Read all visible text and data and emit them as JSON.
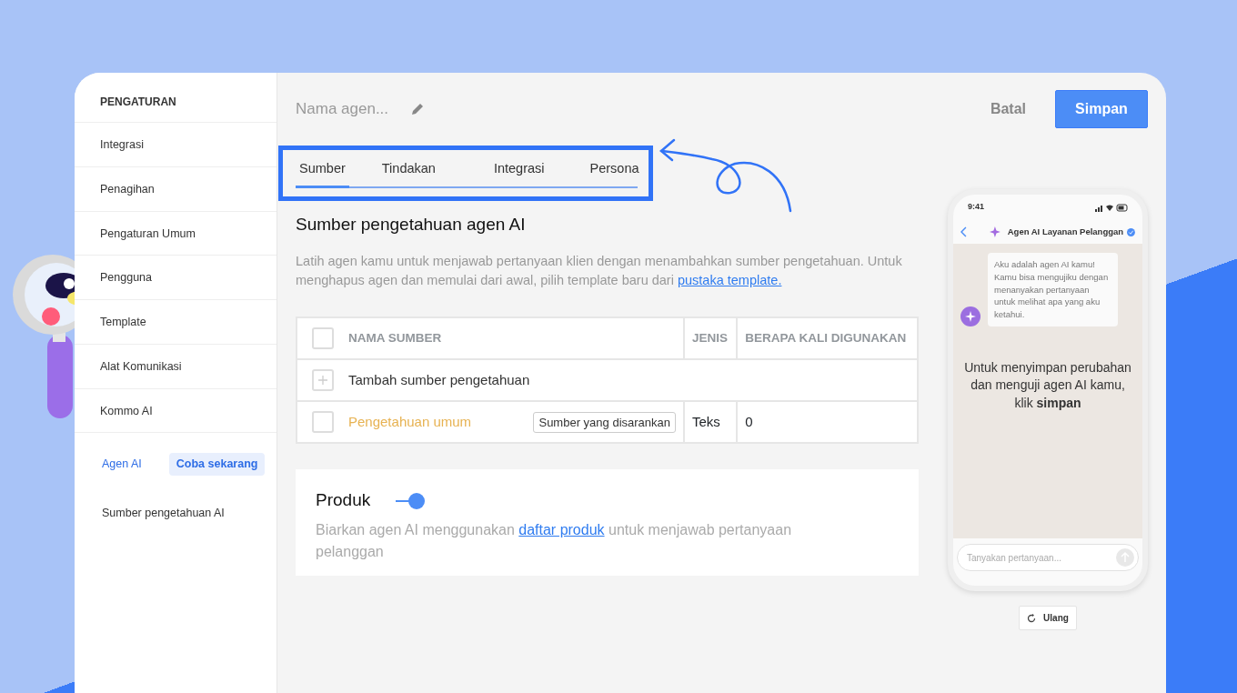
{
  "sidebar": {
    "title": "PENGATURAN",
    "items": [
      {
        "label": "Integrasi"
      },
      {
        "label": "Penagihan"
      },
      {
        "label": "Pengaturan Umum"
      },
      {
        "label": "Pengguna"
      },
      {
        "label": "Template"
      },
      {
        "label": "Alat Komunikasi"
      },
      {
        "label": "Kommo AI"
      }
    ],
    "subitems": [
      {
        "label": "Agen AI",
        "badge": "Coba sekarang",
        "selected": true
      },
      {
        "label": "Sumber pengetahuan AI",
        "selected": false
      }
    ]
  },
  "header": {
    "name_placeholder": "Nama agen...",
    "cancel": "Batal",
    "save": "Simpan"
  },
  "tabs": [
    {
      "label": "Sumber",
      "selected": true
    },
    {
      "label": "Tindakan",
      "selected": false
    },
    {
      "label": "Integrasi",
      "selected": false
    },
    {
      "label": "Persona",
      "selected": false
    }
  ],
  "section": {
    "title": "Sumber pengetahuan agen AI",
    "description": "Latih agen kamu untuk menjawab pertanyaan klien dengan menambahkan sumber pengetahuan. Untuk menghapus agen dan memulai dari awal, pilih template baru dari",
    "link": "pustaka template."
  },
  "table": {
    "columns": [
      "NAMA SUMBER",
      "JENIS",
      "BERAPA KALI DIGUNAKAN"
    ],
    "all_checked": false,
    "add_row": "Tambah sumber pengetahuan",
    "rows": [
      {
        "name": "Pengetahuan umum",
        "tag": "Sumber yang disarankan",
        "type": "Teks",
        "uses": "0",
        "checked": false
      }
    ]
  },
  "product": {
    "title": "Produk",
    "on": true,
    "text_before": "Biarkan agen AI menggunakan",
    "link": "daftar produk",
    "text_after": "untuk menjawab pertanyaan pelanggan"
  },
  "phone": {
    "time": "9:41",
    "chat_title": "Agen AI Layanan Pelanggan",
    "message": "Aku adalah agen AI kamu! Kamu bisa mengujiku dengan menanyakan pertanyaan untuk melihat apa yang aku ketahui.",
    "notice": "Untuk menyimpan perubahan dan menguji agen AI kamu, klik **simpan**",
    "input_placeholder": "Tanyakan pertanyaan...",
    "reset": "Ulang"
  }
}
